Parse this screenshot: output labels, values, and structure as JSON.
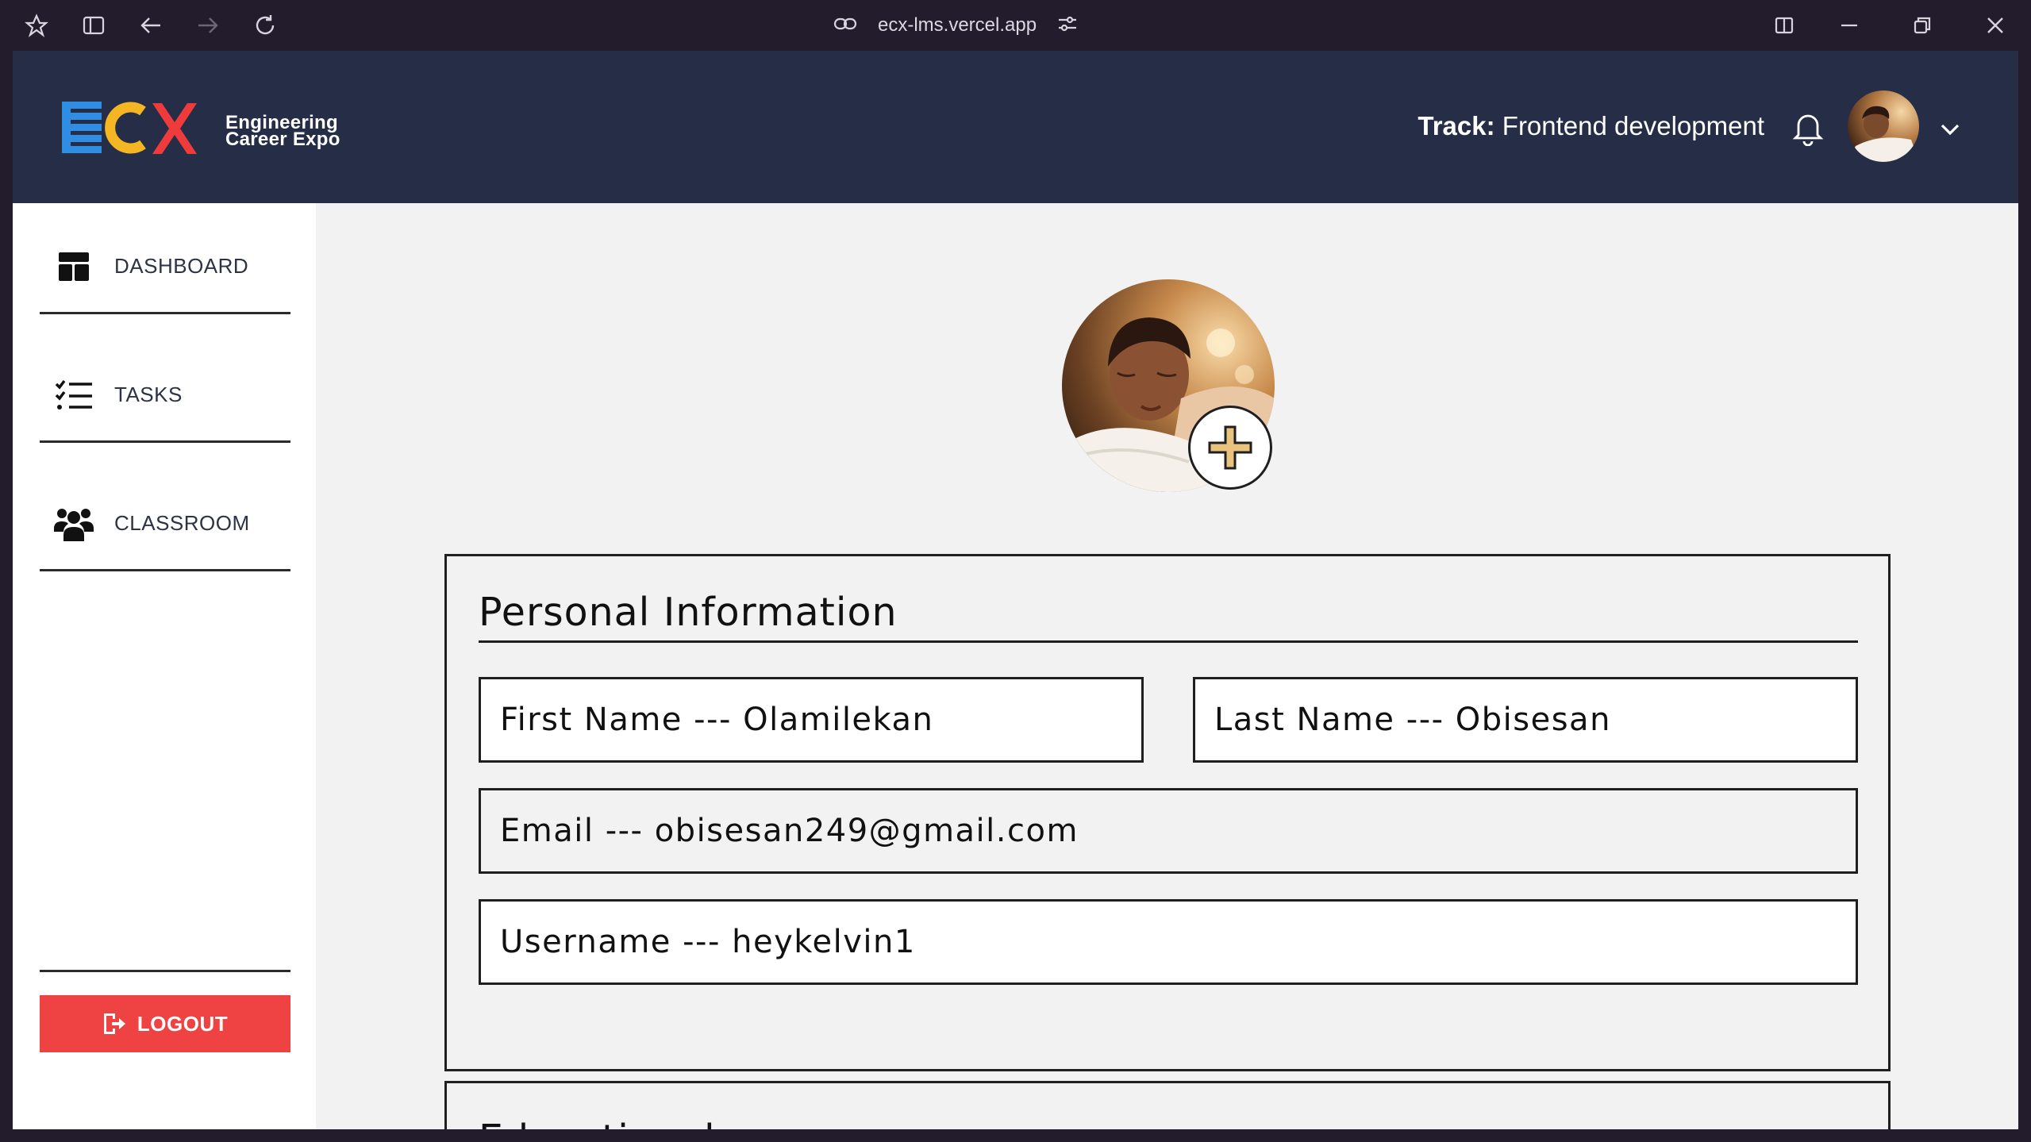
{
  "browser": {
    "url": "ecx-lms.vercel.app"
  },
  "header": {
    "logo_text": "ECX",
    "logo_tagline_line1": "Engineering",
    "logo_tagline_line2": "Career Expo",
    "track_label": "Track:",
    "track_value": "Frontend development"
  },
  "sidebar": {
    "items": [
      {
        "label": "DASHBOARD",
        "icon": "dashboard-icon"
      },
      {
        "label": "TASKS",
        "icon": "tasks-checklist-icon"
      },
      {
        "label": "CLASSROOM",
        "icon": "users-group-icon"
      }
    ],
    "logout_label": "LOGOUT"
  },
  "profile": {
    "personal_info_title": "Personal Information",
    "first_name": "First Name --- Olamilekan",
    "last_name": "Last Name --- Obisesan",
    "email": "Email --- obisesan249@gmail.com",
    "username": "Username --- heykelvin1",
    "next_section_title": "Educational"
  },
  "colors": {
    "header_bg": "#252d47",
    "logout_bg": "#ef4343",
    "logo_blue": "#2f8de4",
    "logo_yellow": "#f5b623",
    "logo_red": "#ef3b3b"
  }
}
